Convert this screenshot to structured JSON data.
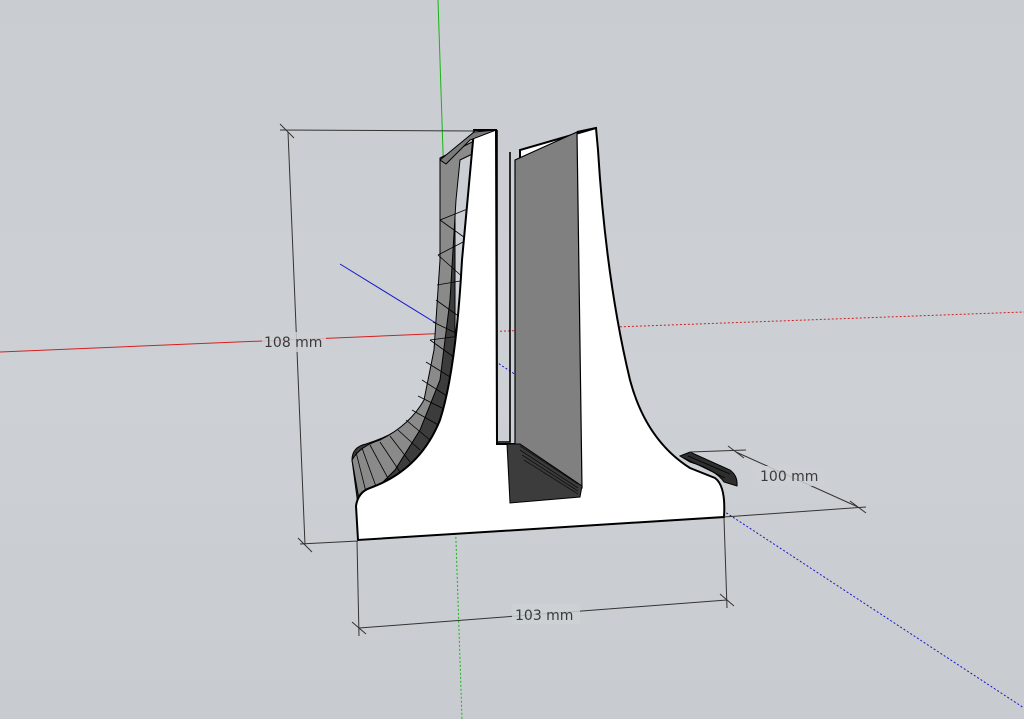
{
  "viewport": {
    "axes": {
      "red": "#d42020",
      "green": "#18b418",
      "blue": "#1818c8"
    },
    "model": {
      "face_color": "#ffffff",
      "inner_face_color": "#808080",
      "edge_color": "#000000"
    },
    "dimensions": {
      "height_label": "108 mm",
      "depth_label": "100 mm",
      "width_label": "103 mm"
    }
  }
}
